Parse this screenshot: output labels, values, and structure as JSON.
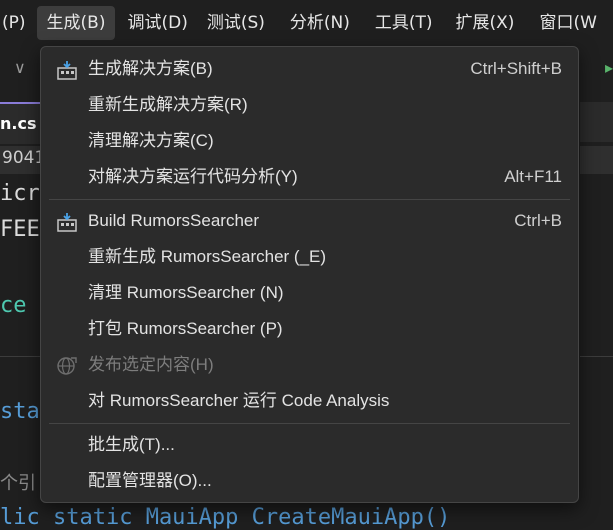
{
  "menubar": {
    "items": [
      {
        "label": "(P)"
      },
      {
        "label": "生成(B)"
      },
      {
        "label": "调试(D)"
      },
      {
        "label": "测试(S)"
      },
      {
        "label": "分析(N)"
      },
      {
        "label": "工具(T)"
      },
      {
        "label": "扩展(X)"
      },
      {
        "label": "窗口(W"
      }
    ]
  },
  "editor": {
    "tab_name": "n.cs",
    "line_fragment": "9041",
    "code_lines": [
      {
        "text": "icr"
      },
      {
        "text": "FEE"
      },
      {
        "text": "ce"
      },
      {
        "text": "sta"
      },
      {
        "text": "个引"
      },
      {
        "text": "lic static MauiApp CreateMauiApp()"
      }
    ]
  },
  "build_menu": {
    "groups": [
      [
        {
          "label": "生成解决方案(B)",
          "shortcut": "Ctrl+Shift+B",
          "icon": "build-solution-icon",
          "enabled": true
        },
        {
          "label": "重新生成解决方案(R)",
          "shortcut": "",
          "icon": "",
          "enabled": true
        },
        {
          "label": "清理解决方案(C)",
          "shortcut": "",
          "icon": "",
          "enabled": true
        },
        {
          "label": "对解决方案运行代码分析(Y)",
          "shortcut": "Alt+F11",
          "icon": "",
          "enabled": true
        }
      ],
      [
        {
          "label": "Build RumorsSearcher",
          "shortcut": "Ctrl+B",
          "icon": "build-project-icon",
          "enabled": true
        },
        {
          "label": "重新生成 RumorsSearcher (_E)",
          "shortcut": "",
          "icon": "",
          "enabled": true
        },
        {
          "label": "清理 RumorsSearcher (N)",
          "shortcut": "",
          "icon": "",
          "enabled": true
        },
        {
          "label": "打包 RumorsSearcher (P)",
          "shortcut": "",
          "icon": "",
          "enabled": true
        },
        {
          "label": "发布选定内容(H)",
          "shortcut": "",
          "icon": "publish-globe-icon",
          "enabled": false
        },
        {
          "label": "对 RumorsSearcher 运行 Code Analysis",
          "shortcut": "",
          "icon": "",
          "enabled": true
        }
      ],
      [
        {
          "label": "批生成(T)...",
          "shortcut": "",
          "icon": "",
          "enabled": true
        },
        {
          "label": "配置管理器(O)...",
          "shortcut": "",
          "icon": "",
          "enabled": true
        }
      ]
    ]
  }
}
